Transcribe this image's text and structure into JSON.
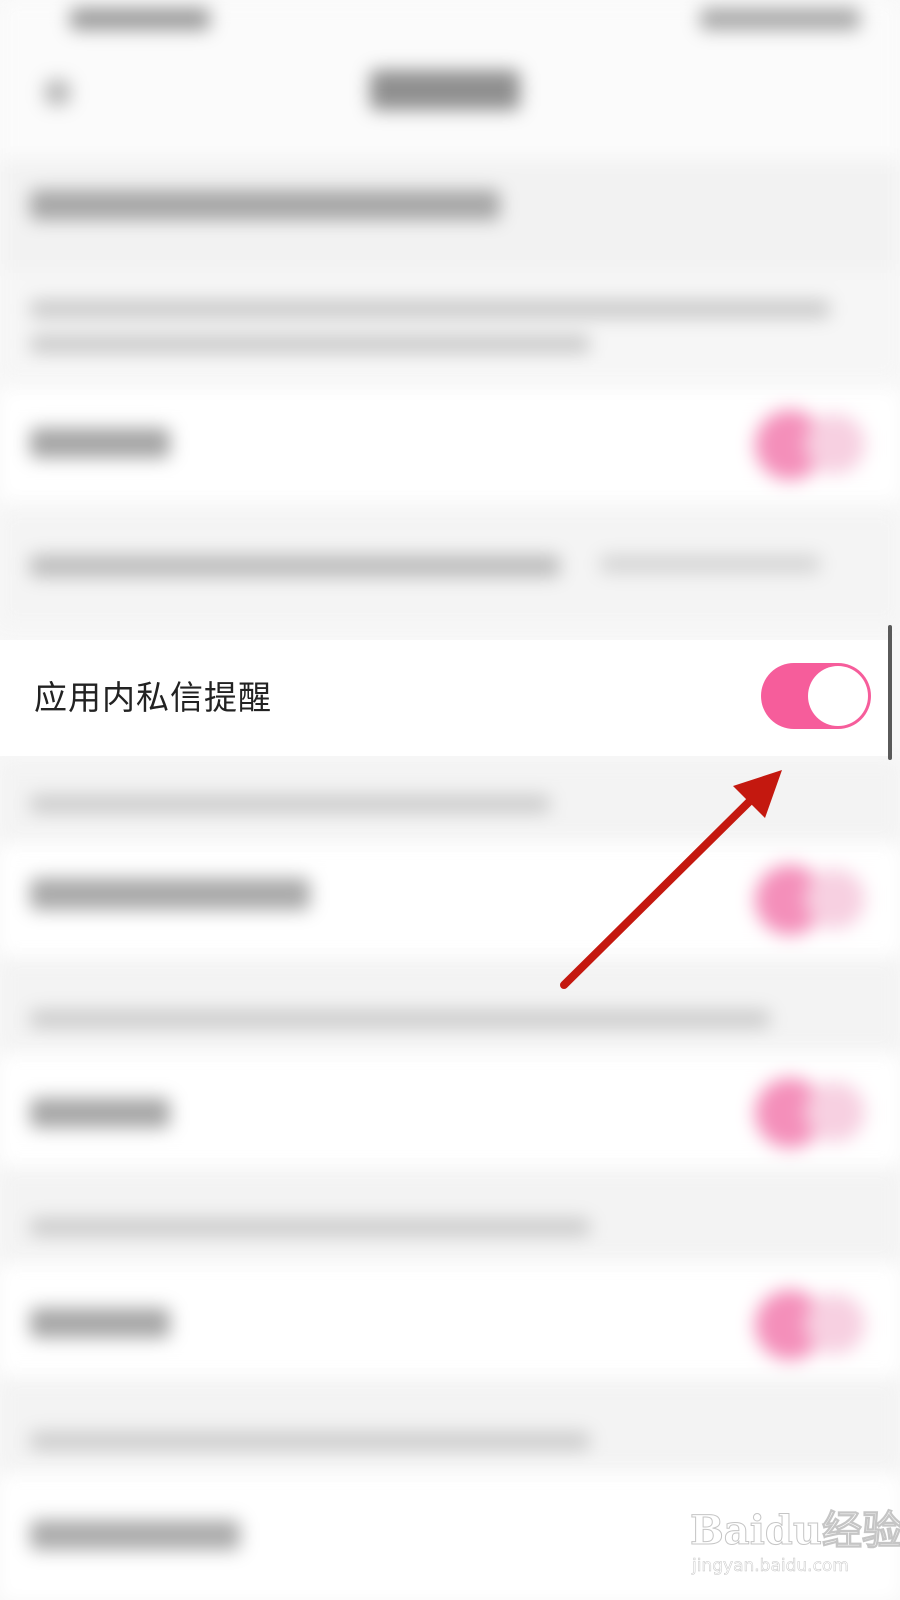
{
  "settings_row": {
    "label": "应用内私信提醒",
    "toggle_on": true
  },
  "watermark": {
    "brand": "Baidu经验",
    "url": "jingyan.baidu.com"
  },
  "colors": {
    "toggle_on": "#f65d9b",
    "toggle_knob": "#ffffff",
    "arrow": "#c4180f",
    "row_background": "#ffffff",
    "page_background": "#f8f8f8"
  },
  "icons": {
    "arrow": "annotation-arrow-icon",
    "watermark_logo": "baidu-paw-logo-icon"
  }
}
